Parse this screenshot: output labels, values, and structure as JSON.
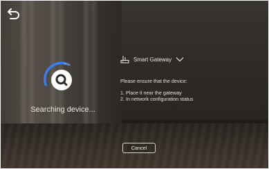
{
  "app": {
    "back_icon": "back-arrow-icon"
  },
  "search": {
    "status_text": "Searching device...",
    "icon": "magnifier-icon",
    "accent_color": "#3a7df0"
  },
  "gateway": {
    "label": "Smart Gateway",
    "icon": "router-icon",
    "dropdown_icon": "chevron-down-icon"
  },
  "instructions": {
    "title": "Please ensure that the device:",
    "items": [
      "1. Place it near the gateway",
      "2. In network configuration status"
    ]
  },
  "actions": {
    "cancel_label": "Cancel"
  }
}
